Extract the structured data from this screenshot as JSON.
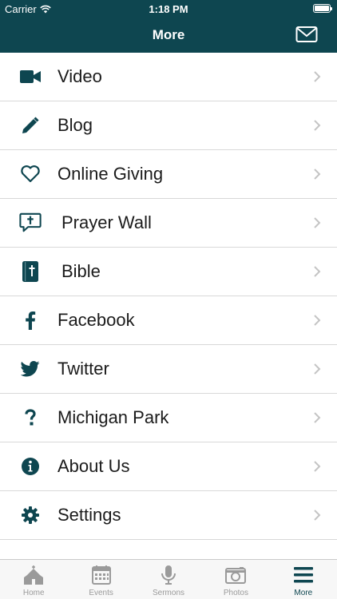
{
  "status_bar": {
    "carrier": "Carrier",
    "time": "1:18 PM"
  },
  "nav": {
    "title": "More"
  },
  "menu": [
    {
      "label": "Video",
      "icon": "video-camera-icon"
    },
    {
      "label": "Blog",
      "icon": "pencil-icon"
    },
    {
      "label": "Online Giving",
      "icon": "heart-icon"
    },
    {
      "label": "Prayer Wall",
      "icon": "prayer-bubble-icon"
    },
    {
      "label": "Bible",
      "icon": "bible-icon"
    },
    {
      "label": "Facebook",
      "icon": "facebook-icon"
    },
    {
      "label": "Twitter",
      "icon": "twitter-icon"
    },
    {
      "label": "Michigan Park",
      "icon": "question-mark-icon"
    },
    {
      "label": "About Us",
      "icon": "info-icon"
    },
    {
      "label": "Settings",
      "icon": "gear-icon"
    }
  ],
  "tabs": [
    {
      "label": "Home",
      "icon": "church-icon",
      "active": false
    },
    {
      "label": "Events",
      "icon": "calendar-icon",
      "active": false
    },
    {
      "label": "Sermons",
      "icon": "microphone-icon",
      "active": false
    },
    {
      "label": "Photos",
      "icon": "camera-icon",
      "active": false
    },
    {
      "label": "More",
      "icon": "hamburger-menu-icon",
      "active": true
    }
  ],
  "colors": {
    "brand": "#0e4650",
    "icon": "#0e4650",
    "inactive_tab": "#9a9a9a",
    "divider": "#d8d8d8"
  }
}
